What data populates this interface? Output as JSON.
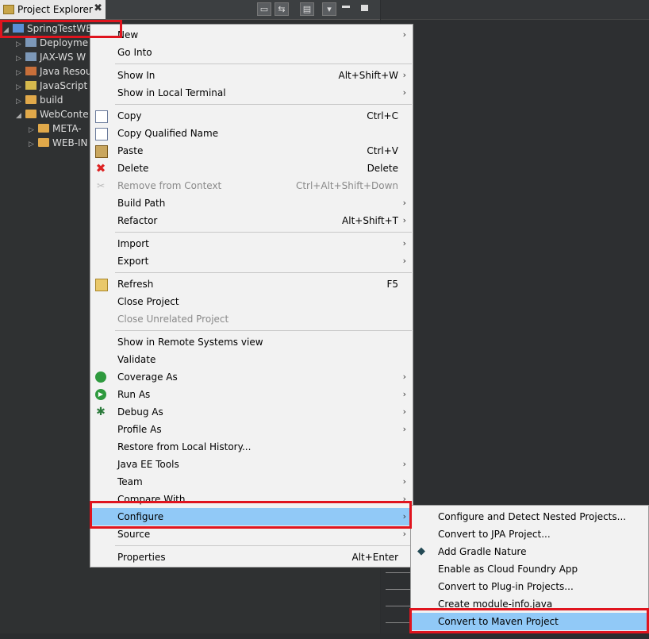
{
  "explorer": {
    "tab_title": "Project Explorer",
    "close_glyph": "✖",
    "tree": [
      {
        "label": "SpringTestWE",
        "arrow": "◢",
        "icon": "project-icon"
      },
      {
        "label": "Deployme",
        "arrow": "▷",
        "icon": "deployment-icon"
      },
      {
        "label": "JAX-WS W",
        "arrow": "▷",
        "icon": "webservice-icon"
      },
      {
        "label": "Java Resou",
        "arrow": "▷",
        "icon": "java-resources-icon"
      },
      {
        "label": "JavaScript",
        "arrow": "▷",
        "icon": "javascript-icon"
      },
      {
        "label": "build",
        "arrow": "▷",
        "icon": "folder-icon"
      },
      {
        "label": "WebConte",
        "arrow": "◢",
        "icon": "folder-icon"
      },
      {
        "label": "META-",
        "arrow": "▷",
        "icon": "folder-icon"
      },
      {
        "label": "WEB-IN",
        "arrow": "▷",
        "icon": "folder-icon"
      }
    ]
  },
  "context_menu": {
    "items": [
      {
        "label": "New",
        "shortcut": "",
        "submenu": true
      },
      {
        "label": "Go Into",
        "shortcut": "",
        "submenu": false
      },
      {
        "label": "Show In",
        "shortcut": "Alt+Shift+W",
        "submenu": true
      },
      {
        "label": "Show in Local Terminal",
        "shortcut": "",
        "submenu": true
      },
      {
        "label": "Copy",
        "shortcut": "Ctrl+C",
        "submenu": false
      },
      {
        "label": "Copy Qualified Name",
        "shortcut": "",
        "submenu": false
      },
      {
        "label": "Paste",
        "shortcut": "Ctrl+V",
        "submenu": false
      },
      {
        "label": "Delete",
        "shortcut": "Delete",
        "submenu": false
      },
      {
        "label": "Remove from Context",
        "shortcut": "Ctrl+Alt+Shift+Down",
        "submenu": false,
        "disabled": true
      },
      {
        "label": "Build Path",
        "shortcut": "",
        "submenu": true
      },
      {
        "label": "Refactor",
        "shortcut": "Alt+Shift+T",
        "submenu": true
      },
      {
        "label": "Import",
        "shortcut": "",
        "submenu": true
      },
      {
        "label": "Export",
        "shortcut": "",
        "submenu": true
      },
      {
        "label": "Refresh",
        "shortcut": "F5",
        "submenu": false
      },
      {
        "label": "Close Project",
        "shortcut": "",
        "submenu": false
      },
      {
        "label": "Close Unrelated Project",
        "shortcut": "",
        "submenu": false,
        "disabled": true
      },
      {
        "label": "Show in Remote Systems view",
        "shortcut": "",
        "submenu": false
      },
      {
        "label": "Validate",
        "shortcut": "",
        "submenu": false
      },
      {
        "label": "Coverage As",
        "shortcut": "",
        "submenu": true
      },
      {
        "label": "Run As",
        "shortcut": "",
        "submenu": true
      },
      {
        "label": "Debug As",
        "shortcut": "",
        "submenu": true
      },
      {
        "label": "Profile As",
        "shortcut": "",
        "submenu": true
      },
      {
        "label": "Restore from Local History...",
        "shortcut": "",
        "submenu": false
      },
      {
        "label": "Java EE Tools",
        "shortcut": "",
        "submenu": true
      },
      {
        "label": "Team",
        "shortcut": "",
        "submenu": true
      },
      {
        "label": "Compare With",
        "shortcut": "",
        "submenu": true
      },
      {
        "label": "Configure",
        "shortcut": "",
        "submenu": true,
        "highlighted": true
      },
      {
        "label": "Source",
        "shortcut": "",
        "submenu": true
      },
      {
        "label": "Properties",
        "shortcut": "Alt+Enter",
        "submenu": false
      }
    ],
    "submenu_glyph": "›"
  },
  "configure_submenu": {
    "items": [
      {
        "label": "Configure and Detect Nested Projects..."
      },
      {
        "label": "Convert to JPA Project..."
      },
      {
        "label": "Add Gradle Nature"
      },
      {
        "label": "Enable as Cloud Foundry App"
      },
      {
        "label": "Convert to Plug-in Projects..."
      },
      {
        "label": "Create module-info.java"
      },
      {
        "label": "Convert to Maven Project",
        "highlighted": true
      }
    ]
  },
  "colors": {
    "highlight": "#91c9f7",
    "annotation_box": "#e0141e",
    "menu_bg": "#f2f2f2",
    "panel_bg": "#2f3132"
  }
}
